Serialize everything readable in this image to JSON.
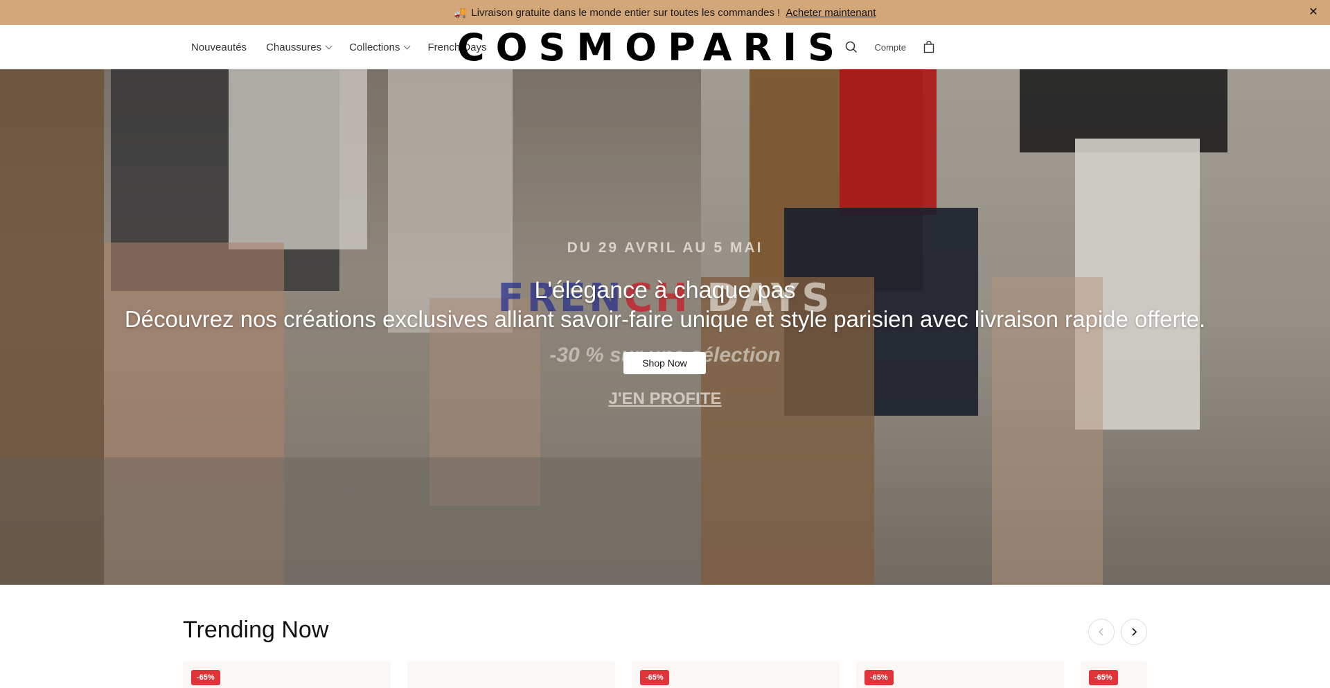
{
  "announcement": {
    "emoji": "🚚",
    "text": "Livraison gratuite dans le monde entier sur toutes les commandes !",
    "link": "Acheter maintenant",
    "close": "✕"
  },
  "header": {
    "nav": [
      {
        "label": "Nouveautés"
      },
      {
        "label": "Chaussures"
      },
      {
        "label": "Collections"
      },
      {
        "label": "French Days"
      }
    ],
    "logo": "COSMOPARIS",
    "account": "Compte"
  },
  "hero": {
    "date": "DU 29 AVRIL AU 5 MAI",
    "french_days": {
      "blue": "FREN",
      "red": "CH",
      "white": " DAYS"
    },
    "title": "L'élégance à chaque pas",
    "subtitle": "Découvrez nos créations exclusives alliant savoir-faire unique et style parisien avec livraison rapide offerte.",
    "promo": "-30 % sur une sélection",
    "button": "Shop Now",
    "cta": "J'EN PROFITE"
  },
  "trending": {
    "title": "Trending Now",
    "cards": [
      {
        "badge": "-65%"
      },
      {
        "badge": ""
      },
      {
        "badge": "-65%"
      },
      {
        "badge": "-65%"
      },
      {
        "badge": "-65%"
      }
    ]
  }
}
